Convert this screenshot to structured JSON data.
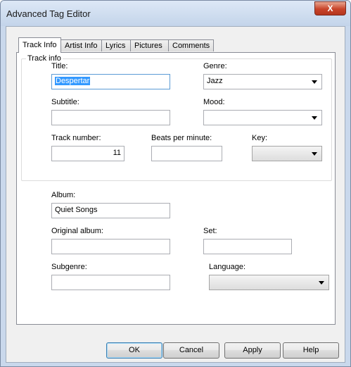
{
  "window": {
    "title": "Advanced Tag Editor",
    "close_glyph": "X"
  },
  "tabs": [
    {
      "label": "Track Info",
      "active": true
    },
    {
      "label": "Artist Info",
      "active": false
    },
    {
      "label": "Lyrics",
      "active": false
    },
    {
      "label": "Pictures",
      "active": false
    },
    {
      "label": "Comments",
      "active": false
    }
  ],
  "track_info": {
    "legend": "Track info",
    "title": {
      "label": "Title:",
      "value": "Despertar"
    },
    "genre": {
      "label": "Genre:",
      "value": "Jazz"
    },
    "subtitle": {
      "label": "Subtitle:",
      "value": ""
    },
    "mood": {
      "label": "Mood:",
      "value": ""
    },
    "track_number": {
      "label": "Track number:",
      "value": "11"
    },
    "bpm": {
      "label": "Beats per minute:",
      "value": ""
    },
    "key": {
      "label": "Key:",
      "value": ""
    }
  },
  "album_info": {
    "album": {
      "label": "Album:",
      "value": "Quiet Songs"
    },
    "original_album": {
      "label": "Original album:",
      "value": ""
    },
    "set": {
      "label": "Set:",
      "value": ""
    },
    "subgenre": {
      "label": "Subgenre:",
      "value": ""
    },
    "language": {
      "label": "Language:",
      "value": ""
    }
  },
  "buttons": {
    "ok": "OK",
    "cancel": "Cancel",
    "apply": "Apply",
    "help": "Help"
  }
}
